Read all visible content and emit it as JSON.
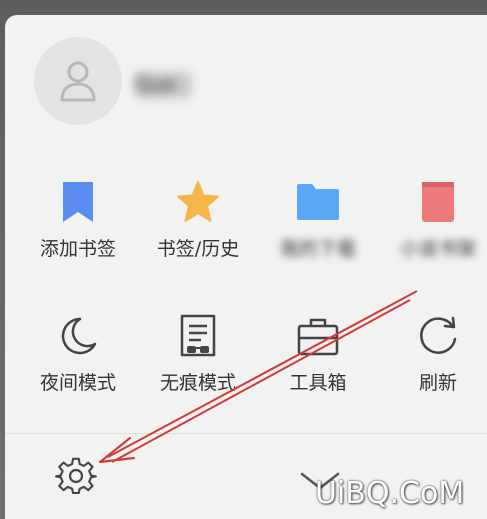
{
  "profile": {
    "username": "Guo"
  },
  "row1": [
    {
      "label": "添加书签",
      "icon": "bookmark-icon"
    },
    {
      "label": "书签/历史",
      "icon": "star-icon"
    },
    {
      "label": "我的下载",
      "icon": "folder-icon"
    },
    {
      "label": "小说书架",
      "icon": "book-icon"
    }
  ],
  "row2": [
    {
      "label": "夜间模式",
      "icon": "moon-icon"
    },
    {
      "label": "无痕模式",
      "icon": "incognito-icon"
    },
    {
      "label": "工具箱",
      "icon": "toolbox-icon"
    },
    {
      "label": "刷新",
      "icon": "refresh-icon"
    }
  ],
  "footer": {
    "settings_icon": "gear-icon",
    "collapse_icon": "chevron-down-icon"
  },
  "watermark": "UiBQ.CoM",
  "colors": {
    "bookmark": "#5b8def",
    "star": "#f6b54a",
    "folder": "#5aa8f5",
    "book": "#ec7a78",
    "annotation_arrow": "#d33a3a"
  }
}
